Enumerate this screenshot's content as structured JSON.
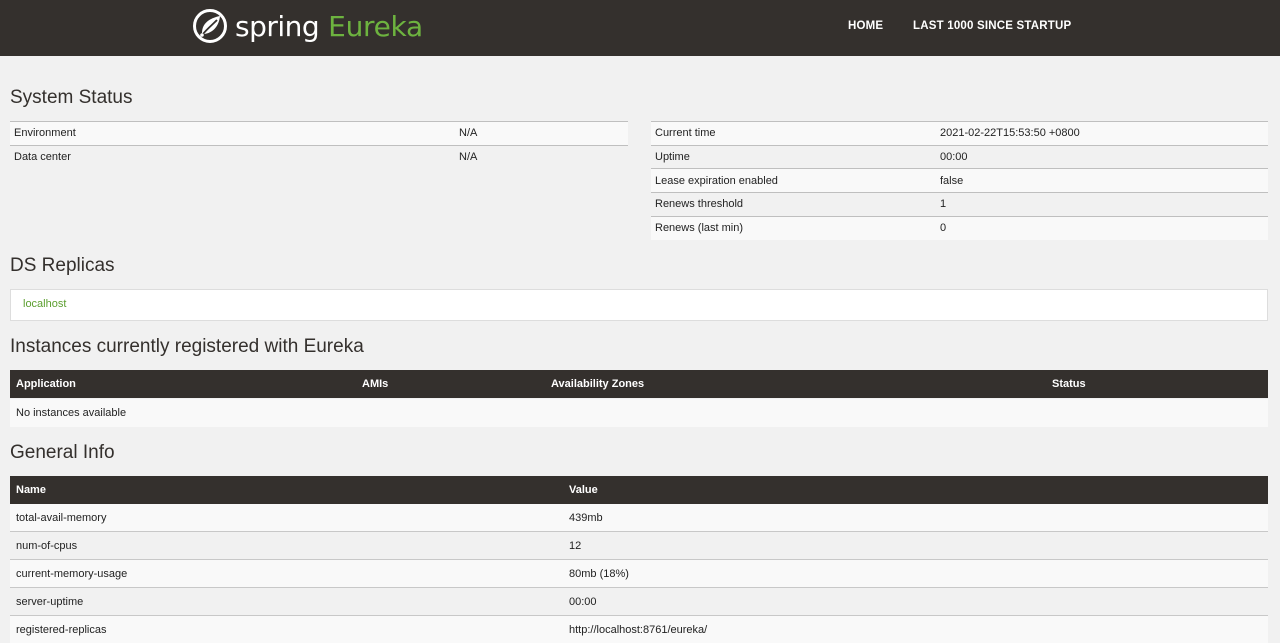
{
  "header": {
    "logo_word1": "spring",
    "logo_word2": "Eureka",
    "nav": {
      "home": "HOME",
      "last1000": "LAST 1000 SINCE STARTUP"
    }
  },
  "system_status": {
    "title": "System Status",
    "left_rows": [
      {
        "label": "Environment",
        "value": "N/A"
      },
      {
        "label": "Data center",
        "value": "N/A"
      }
    ],
    "right_rows": [
      {
        "label": "Current time",
        "value": "2021-02-22T15:53:50 +0800"
      },
      {
        "label": "Uptime",
        "value": "00:00"
      },
      {
        "label": "Lease expiration enabled",
        "value": "false"
      },
      {
        "label": "Renews threshold",
        "value": "1"
      },
      {
        "label": "Renews (last min)",
        "value": "0"
      }
    ]
  },
  "ds_replicas": {
    "title": "DS Replicas",
    "link": "localhost"
  },
  "instances": {
    "title": "Instances currently registered with Eureka",
    "columns": [
      "Application",
      "AMIs",
      "Availability Zones",
      "Status"
    ],
    "empty_text": "No instances available"
  },
  "general_info": {
    "title": "General Info",
    "columns": [
      "Name",
      "Value"
    ],
    "rows": [
      {
        "name": "total-avail-memory",
        "value": "439mb"
      },
      {
        "name": "num-of-cpus",
        "value": "12"
      },
      {
        "name": "current-memory-usage",
        "value": "80mb (18%)"
      },
      {
        "name": "server-uptime",
        "value": "00:00"
      },
      {
        "name": "registered-replicas",
        "value": "http://localhost:8761/eureka/"
      }
    ]
  },
  "colors": {
    "header_bg": "#34302d",
    "brand_green": "#6db33f",
    "link_green": "#5b9e2e"
  }
}
